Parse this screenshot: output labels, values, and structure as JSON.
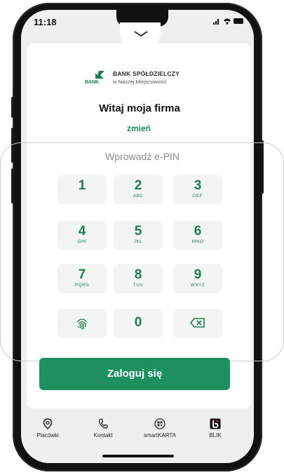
{
  "status": {
    "time": "11:18",
    "signal_icons": ".ıl ≈ ▬"
  },
  "logo": {
    "name": "BANK SPÓŁDZIELCZY",
    "subtitle": "w Naszej Miejscowości",
    "mark_text": "BANK"
  },
  "welcome": "Witaj moja firma",
  "change_link": "zmień",
  "pin_hint": "Wprowadź e-PIN",
  "keypad": [
    {
      "num": "1",
      "letters": ""
    },
    {
      "num": "2",
      "letters": "ABC"
    },
    {
      "num": "3",
      "letters": "DEF"
    },
    {
      "num": "4",
      "letters": "GHI"
    },
    {
      "num": "5",
      "letters": "JKL"
    },
    {
      "num": "6",
      "letters": "MNO"
    },
    {
      "num": "7",
      "letters": "PQRS"
    },
    {
      "num": "8",
      "letters": "TUV"
    },
    {
      "num": "9",
      "letters": "WXYZ"
    },
    {
      "num": "0",
      "letters": ""
    }
  ],
  "login_button": "Zaloguj się",
  "nav": [
    {
      "label": "Placówki",
      "icon": "location-pin-icon"
    },
    {
      "label": "Kontakt",
      "icon": "phone-icon"
    },
    {
      "label": "smartKARTA",
      "icon": "smartkarta-icon"
    },
    {
      "label": "BLIK",
      "icon": "blik-icon"
    }
  ],
  "colors": {
    "accent": "#1e8f5f",
    "key_text": "#1b7e4c",
    "background": "#eef0ef"
  }
}
